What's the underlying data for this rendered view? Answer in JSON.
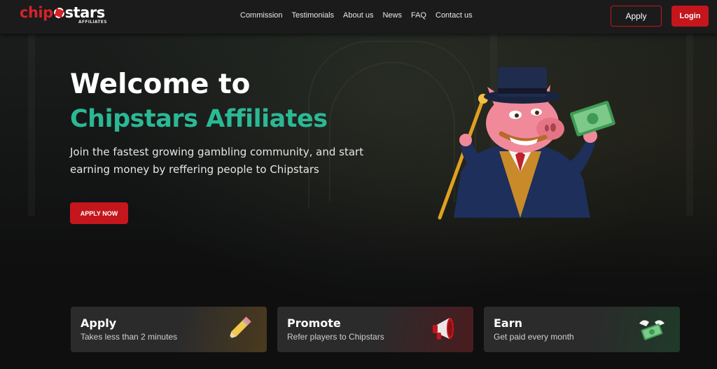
{
  "header": {
    "logo": {
      "chip": "chip",
      "stars": "stars",
      "sub": "AFFILIATES"
    },
    "nav": [
      "Commission",
      "Testimonials",
      "About us",
      "News",
      "FAQ",
      "Contact us"
    ],
    "apply_label": "Apply",
    "login_label": "Login"
  },
  "hero": {
    "title_line1": "Welcome to",
    "title_line2": "Chipstars Affiliates",
    "description": "Join the fastest growing gambling community, and start earning money by reffering people to Chipstars",
    "cta_label": "APPLY NOW"
  },
  "cards": [
    {
      "title": "Apply",
      "subtitle": "Takes less than 2 minutes",
      "icon": "pencil-icon"
    },
    {
      "title": "Promote",
      "subtitle": "Refer players to Chipstars",
      "icon": "megaphone-icon"
    },
    {
      "title": "Earn",
      "subtitle": "Get paid every month",
      "icon": "flying-money-icon"
    }
  ],
  "colors": {
    "brand_red": "#c4161c",
    "accent_green": "#2bb895",
    "background": "#0f0f10",
    "header": "#1b1b1c"
  }
}
